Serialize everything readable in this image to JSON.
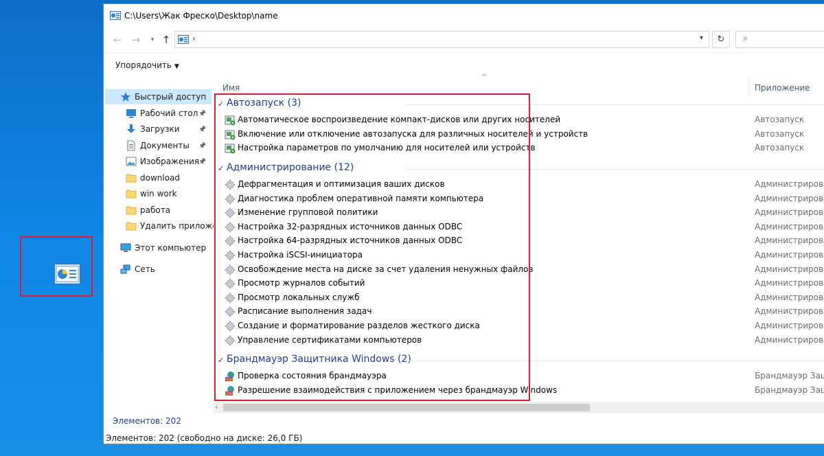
{
  "window": {
    "title": "C:\\Users\\Жак Фреско\\Desktop\\name",
    "address_chevron": "›",
    "refresh_glyph": "↻",
    "search_glyph": "⌕"
  },
  "commandbar": {
    "organize_label": "Упорядочить"
  },
  "columns": {
    "name": "Имя",
    "app": "Приложение"
  },
  "nav": {
    "items": [
      {
        "label": "Быстрый доступ",
        "icon": "star-icon",
        "pinned": false,
        "selected": true
      },
      {
        "label": "Рабочий стол",
        "icon": "desktop-icon",
        "pinned": true
      },
      {
        "label": "Загрузки",
        "icon": "download-arrow-icon",
        "pinned": true
      },
      {
        "label": "Документы",
        "icon": "document-icon",
        "pinned": true
      },
      {
        "label": "Изображения",
        "icon": "pictures-icon",
        "pinned": true
      },
      {
        "label": "download",
        "icon": "folder-icon",
        "pinned": false
      },
      {
        "label": "win work",
        "icon": "folder-icon",
        "pinned": false
      },
      {
        "label": "работа",
        "icon": "folder-icon",
        "pinned": false
      },
      {
        "label": "Удалить приложен",
        "icon": "folder-icon",
        "pinned": false
      },
      {
        "label": "Этот компьютер",
        "icon": "computer-icon",
        "pinned": false
      },
      {
        "label": "Сеть",
        "icon": "network-icon",
        "pinned": false
      }
    ],
    "count_label": "Элементов: 202"
  },
  "groups": [
    {
      "title": "Автозапуск (3)",
      "icon": "autoplay-icon",
      "items": [
        {
          "name": "Автоматическое воспроизведение компакт-дисков или других носителей",
          "app": "Автозапуск"
        },
        {
          "name": "Включение или отключение автозапуска для различных носителей и устройств",
          "app": "Автозапуск"
        },
        {
          "name": "Настройка параметров по умолчанию для носителей или устройств",
          "app": "Автозапуск"
        }
      ]
    },
    {
      "title": "Администрирование (12)",
      "icon": "admin-tools-icon",
      "items": [
        {
          "name": "Дефрагментация и оптимизация ваших дисков",
          "app": "Администрирование"
        },
        {
          "name": "Диагностика проблем оперативной памяти компьютера",
          "app": "Администрирование"
        },
        {
          "name": "Изменение групповой политики",
          "app": "Администрирование"
        },
        {
          "name": "Настройка 32-разрядных источников данных ODBC",
          "app": "Администрирование"
        },
        {
          "name": "Настройка 64-разрядных источников данных ODBC",
          "app": "Администрирование"
        },
        {
          "name": "Настройка iSCSI-инициатора",
          "app": "Администрирование"
        },
        {
          "name": "Освобождение места на диске за счет удаления ненужных файлов",
          "app": "Администрирование"
        },
        {
          "name": "Просмотр журналов событий",
          "app": "Администрирование"
        },
        {
          "name": "Просмотр локальных служб",
          "app": "Администрирование"
        },
        {
          "name": "Расписание выполнения задач",
          "app": "Администрирование"
        },
        {
          "name": "Создание и форматирование разделов жесткого диска",
          "app": "Администрирование"
        },
        {
          "name": "Управление сертификатами компьютеров",
          "app": "Администрирование"
        }
      ]
    },
    {
      "title": "Брандмауэр Защитника Windows (2)",
      "icon": "firewall-icon",
      "items": [
        {
          "name": "Проверка состояния брандмауэра",
          "app": "Брандмауэр Защит"
        },
        {
          "name": "Разрешение взаимодействия с приложением через брандмауэр Windows",
          "app": "Брандмауэр Защит"
        }
      ]
    }
  ],
  "statusbar": {
    "text": "Элементов: 202 (свободно на диске: 26,0 ГБ)"
  },
  "colors": {
    "highlight_red": "#e21b2c",
    "group_blue": "#1e3a9e",
    "desktop_blue": "#0a79d6",
    "selection": "#cce8ff"
  }
}
